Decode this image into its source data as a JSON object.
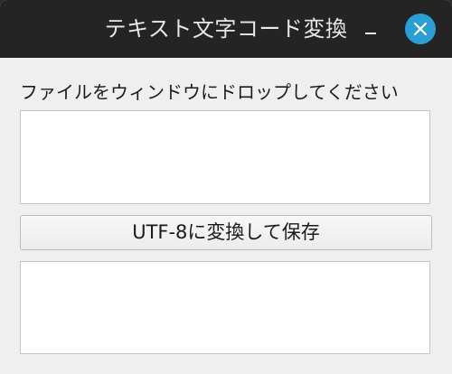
{
  "window": {
    "title": "テキスト文字コード変換",
    "minimize_icon": "minimize-icon",
    "close_icon": "close-icon",
    "accent_color": "#2a9fd6",
    "titlebar_color": "#242424"
  },
  "main": {
    "drop_label": "ファイルをウィンドウにドロップしてください",
    "input_text": "",
    "convert_button_label": "UTF-8に変換して保存",
    "output_text": ""
  }
}
